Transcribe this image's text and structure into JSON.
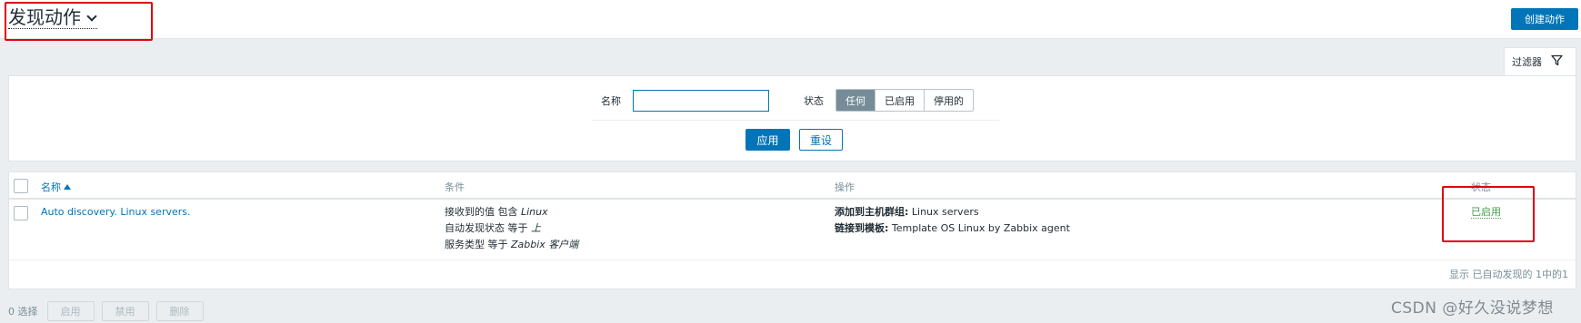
{
  "header": {
    "title": "发现动作",
    "create_button": "创建动作"
  },
  "filter": {
    "tab_label": "过滤器",
    "name_label": "名称",
    "name_value": "",
    "status_label": "状态",
    "status_options": [
      "任何",
      "已启用",
      "停用的"
    ],
    "status_selected": "任何",
    "apply_button": "应用",
    "reset_button": "重设"
  },
  "table": {
    "columns": {
      "name": "名称",
      "conditions": "条件",
      "operations": "操作",
      "status": "状态"
    },
    "rows": [
      {
        "name": "Auto discovery. Linux servers.",
        "conditions": [
          {
            "prefix": "接收到的值 包含 ",
            "value": "Linux"
          },
          {
            "prefix": "自动发现状态 等于 ",
            "value": "上"
          },
          {
            "prefix": "服务类型 等于 ",
            "value": "Zabbix 客户端"
          }
        ],
        "operations": [
          {
            "label": "添加到主机群组:",
            "value": " Linux servers"
          },
          {
            "label": "链接到模板:",
            "value": " Template OS Linux by Zabbix agent"
          }
        ],
        "status": "已启用"
      }
    ],
    "summary": "显示 已自动发现的 1中的1"
  },
  "bottom_bar": {
    "selected_count": "0 选择",
    "enable_button": "启用",
    "disable_button": "禁用",
    "delete_button": "删除"
  },
  "watermark": "CSDN @好久没说梦想",
  "colors": {
    "primary": "#0275b8",
    "enabled": "#429e47",
    "highlight_box": "#e0000b"
  }
}
